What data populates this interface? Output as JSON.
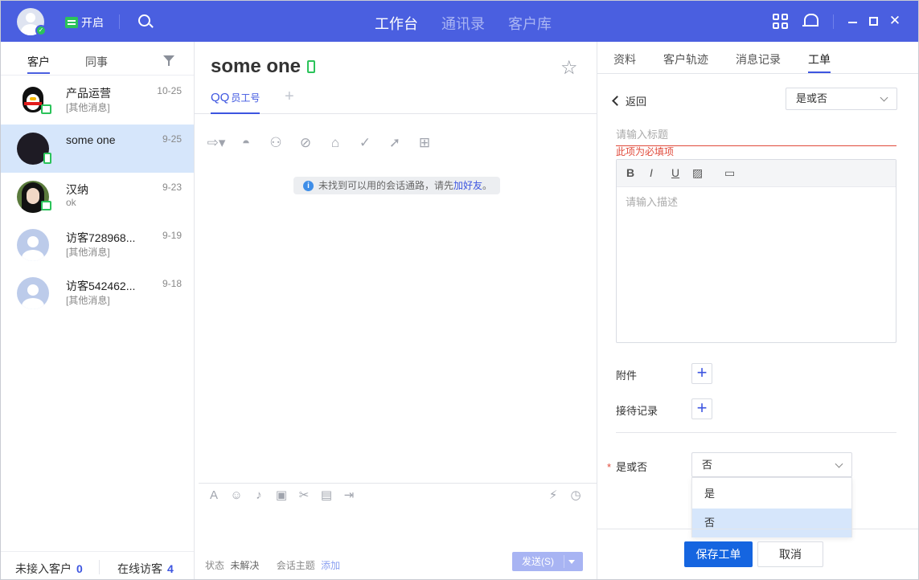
{
  "topbar": {
    "status_label": "开启",
    "nav": [
      "工作台",
      "通讯录",
      "客户库"
    ],
    "nav_active": 0
  },
  "left": {
    "tabs": [
      "客户",
      "同事"
    ],
    "active_tab": 0,
    "contacts": [
      {
        "name": "产品运营",
        "sub": "[其他消息]",
        "time": "10-25",
        "avatar": "penguin",
        "device": "pc"
      },
      {
        "name": "some one",
        "sub": "",
        "time": "9-25",
        "avatar": "dark",
        "device": "phone",
        "selected": true
      },
      {
        "name": "汉纳",
        "sub": "ok",
        "time": "9-23",
        "avatar": "girl",
        "device": "pc"
      },
      {
        "name": "访客728968...",
        "sub": "[其他消息]",
        "time": "9-19",
        "avatar": "visitor",
        "device": ""
      },
      {
        "name": "访客542462...",
        "sub": "[其他消息]",
        "time": "9-18",
        "avatar": "visitor",
        "device": ""
      }
    ],
    "footer": {
      "unaccepted_label": "未接入客户",
      "unaccepted_count": "0",
      "online_label": "在线访客",
      "online_count": "4"
    }
  },
  "chat": {
    "title": "some one",
    "tab_label": "QQ",
    "tab_sub": "员工号",
    "notice_text": "未找到可以用的会话通路，请先",
    "notice_link": "加好友",
    "notice_end": "。",
    "status_label": "状态",
    "status_value": "未解决",
    "topic_label": "会话主题",
    "topic_action": "添加",
    "send_label": "发送(S)"
  },
  "right": {
    "tabs": [
      "资料",
      "客户轨迹",
      "消息记录",
      "工单"
    ],
    "active_tab": 3,
    "back_label": "返回",
    "type_select": "是或否",
    "title_placeholder": "请输入标题",
    "title_error": "此项为必填项",
    "desc_placeholder": "请输入描述",
    "attachment_label": "附件",
    "record_label": "接待记录",
    "field_label": "是或否",
    "field_value": "否",
    "options": [
      "是",
      "否"
    ],
    "highlighted_option": 1,
    "save_label": "保存工单",
    "cancel_label": "取消"
  }
}
